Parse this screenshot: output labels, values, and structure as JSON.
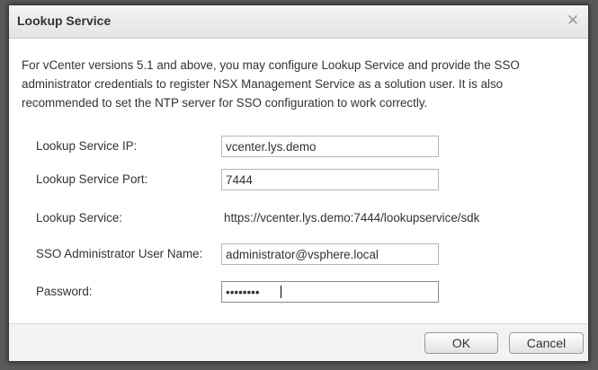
{
  "dialog": {
    "title": "Lookup Service",
    "close_icon": "close-icon",
    "description": "For vCenter versions 5.1 and above, you may configure Lookup Service and provide the SSO administrator credentials to register NSX Management Service as a solution user. It is also recommended to set the NTP server for SSO configuration to work correctly."
  },
  "form": {
    "lookup_ip": {
      "label": "Lookup Service IP:",
      "value": "vcenter.lys.demo"
    },
    "lookup_port": {
      "label": "Lookup Service Port:",
      "value": "7444"
    },
    "lookup_service": {
      "label": "Lookup Service:",
      "value": "https://vcenter.lys.demo:7444/lookupservice/sdk"
    },
    "sso_user": {
      "label": "SSO Administrator User Name:",
      "value": "administrator@vsphere.local"
    },
    "password": {
      "label": "Password:",
      "value": "••••••••"
    }
  },
  "footer": {
    "ok_label": "OK",
    "cancel_label": "Cancel"
  }
}
